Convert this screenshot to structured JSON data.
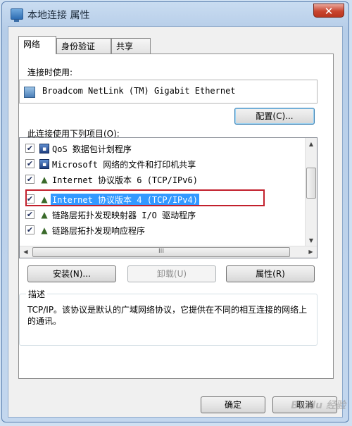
{
  "window": {
    "title": "本地连接 属性",
    "close_glyph": "✕"
  },
  "tabs": [
    {
      "label": "网络",
      "active": true
    },
    {
      "label": "身份验证",
      "active": false
    },
    {
      "label": "共享",
      "active": false
    }
  ],
  "connect_using": {
    "label": "连接时使用:",
    "adapter": "Broadcom NetLink (TM) Gigabit Ethernet",
    "configure_button": "配置(C)..."
  },
  "items_section": {
    "label": "此连接使用下列项目(O):",
    "items": [
      {
        "label": "QoS 数据包计划程序",
        "checked": true,
        "icon": "service-icon"
      },
      {
        "label": "Microsoft 网络的文件和打印机共享",
        "checked": true,
        "icon": "service-icon"
      },
      {
        "label": "Internet 协议版本 6 (TCP/IPv6)",
        "checked": true,
        "icon": "protocol-icon"
      },
      {
        "label": "Internet 协议版本 4 (TCP/IPv4)",
        "checked": true,
        "icon": "protocol-icon",
        "selected": true
      },
      {
        "label": "链路层拓扑发现映射器 I/O 驱动程序",
        "checked": true,
        "icon": "protocol-icon"
      },
      {
        "label": "链路层拓扑发现响应程序",
        "checked": true,
        "icon": "protocol-icon"
      }
    ],
    "hscroll_grip": "III"
  },
  "actions": {
    "install": "安装(N)...",
    "uninstall": "卸载(U)",
    "properties": "属性(R)"
  },
  "description": {
    "title": "描述",
    "text": "TCP/IP。该协议是默认的广域网络协议，它提供在不同的相互连接的网络上的通讯。"
  },
  "footer": {
    "ok": "确定",
    "cancel": "取消",
    "watermark": "Baidu 经验"
  },
  "colors": {
    "selection": "#3399ff",
    "highlight_border": "#c2202c"
  }
}
